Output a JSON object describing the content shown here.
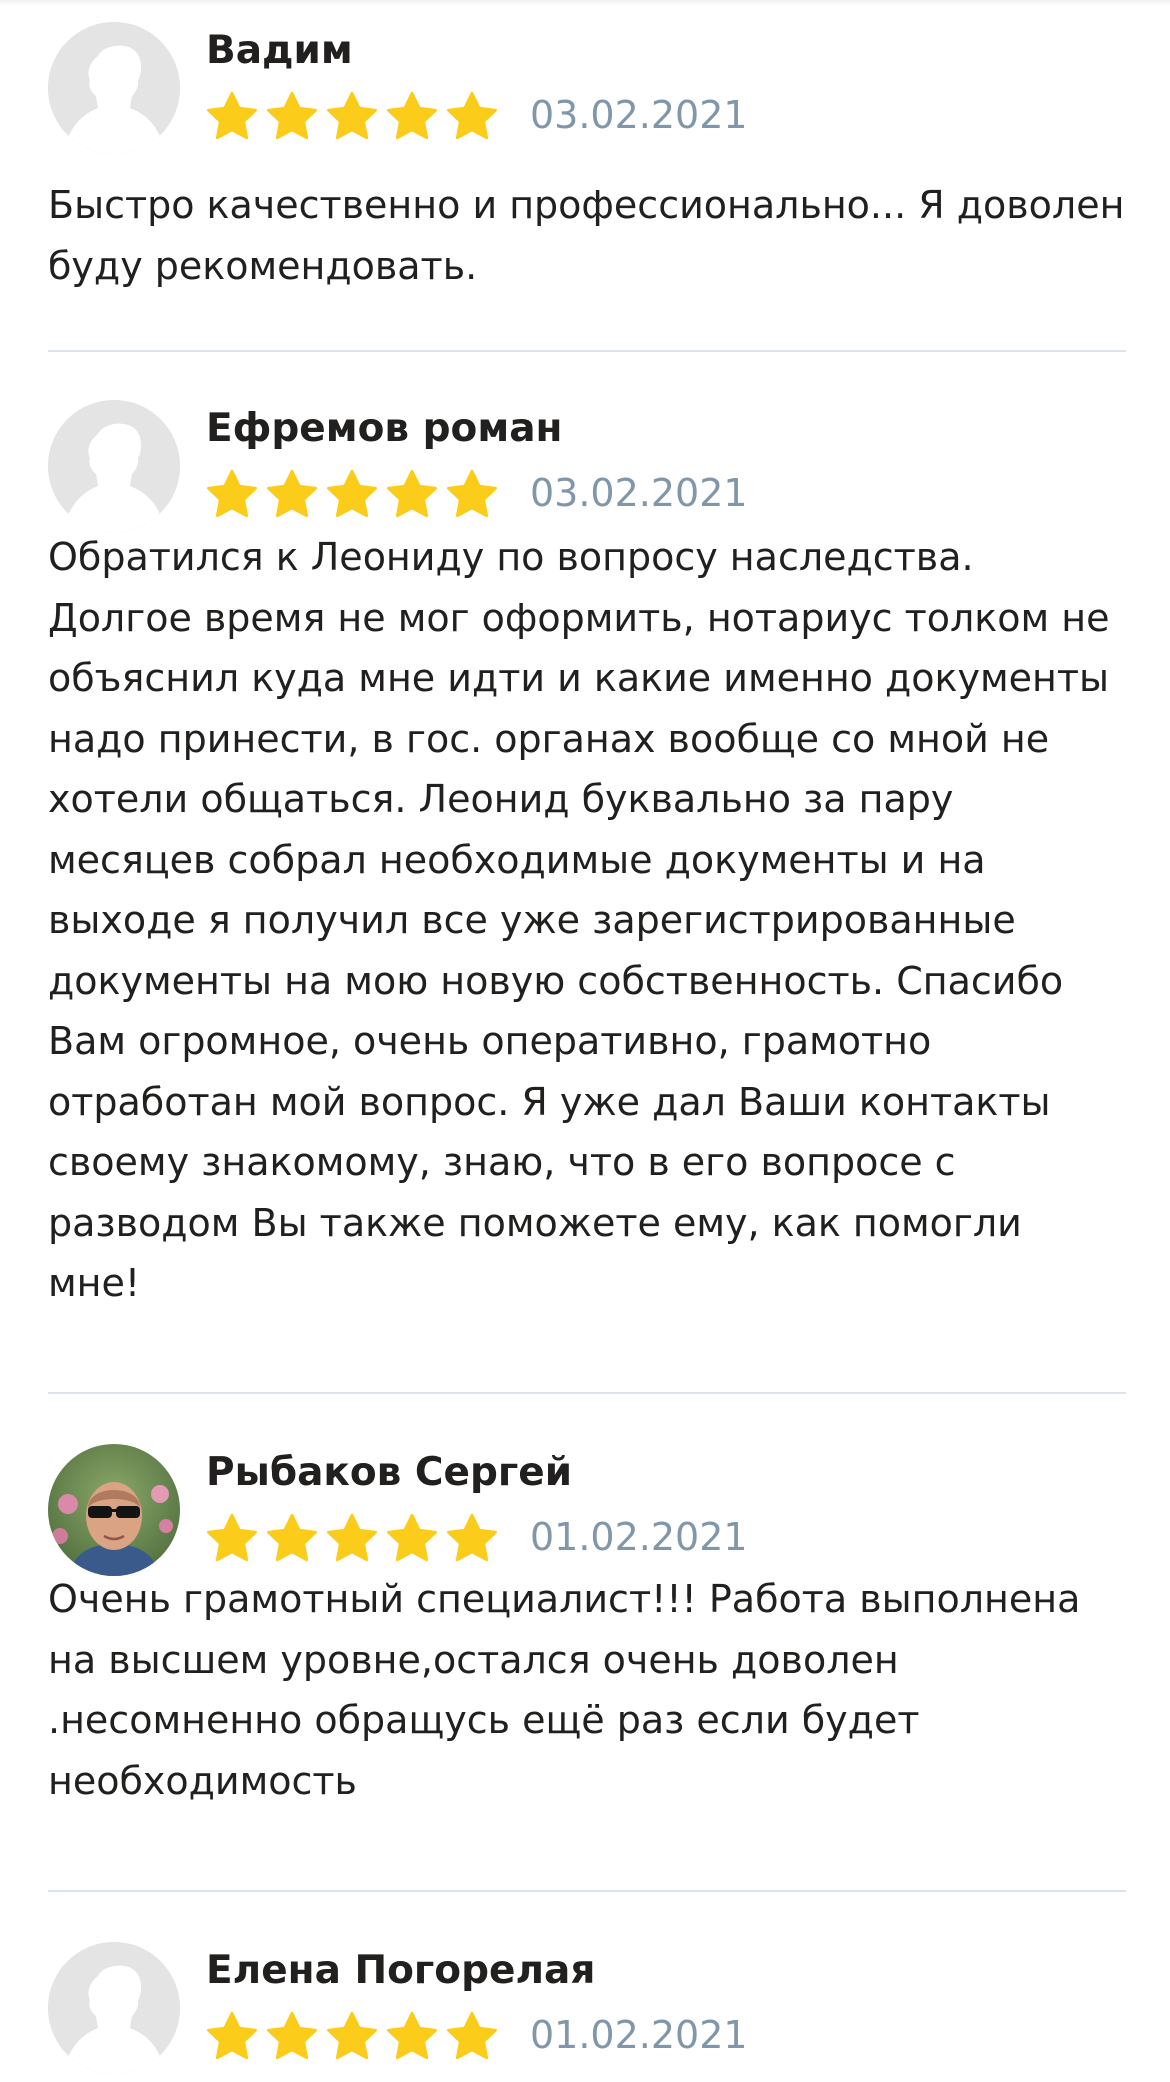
{
  "reviews": [
    {
      "author": "Вадим",
      "rating": 5,
      "date": "03.02.2021",
      "avatar": "default-avatar",
      "text": "Быстро качественно и профессионально... Я доволен буду рекомендовать."
    },
    {
      "author": "Ефремов роман",
      "rating": 5,
      "date": "03.02.2021",
      "avatar": "default-avatar",
      "text": "Обратился к Леониду по вопросу наследства. Долгое время не мог оформить, нотариус толком не объяснил куда мне идти и какие именно документы надо принести, в гос. органах вообще со мной не хотели общаться. Леонид буквально за пару месяцев собрал необходимые документы и на выходе я получил все уже зарегистрированные документы на мою новую собственность. Спасибо Вам огромное, очень оперативно, грамотно отработан мой вопрос. Я уже дал Ваши контакты своему знакомому, знаю, что в его вопросе с разводом Вы также поможете ему, как помогли мне!"
    },
    {
      "author": "Рыбаков Сергей",
      "rating": 5,
      "date": "01.02.2021",
      "avatar": "user-photo",
      "text": "Очень грамотный специалист!!! Работа выполнена на высшем уровне,остался очень доволен .несомненно обращусь ещё раз если будет необходимость"
    },
    {
      "author": "Елена Погорелая",
      "rating": 5,
      "date": "01.02.2021",
      "avatar": "default-avatar",
      "text": ""
    }
  ],
  "colors": {
    "star": "#fccc1a",
    "date": "#7f96ab",
    "divider": "#dde3ea",
    "text": "#21201f"
  },
  "icons": {
    "star": "star-icon",
    "avatar_placeholder": "user-silhouette-icon"
  }
}
